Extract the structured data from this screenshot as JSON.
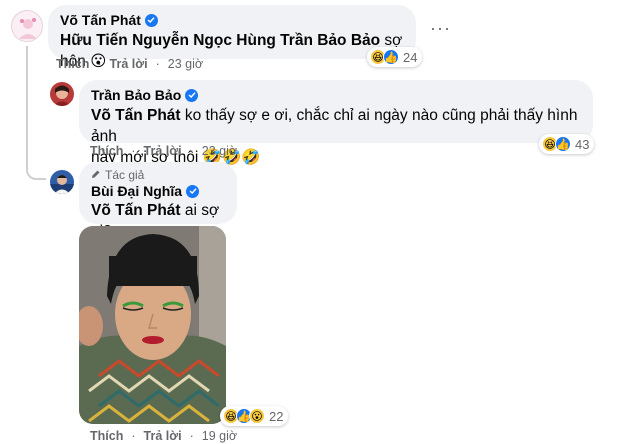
{
  "comment1": {
    "author": "Võ Tấn Phát",
    "text": "Hữu Tiến Nguyễn Ngọc Hùng Trần Bảo Bảo",
    "suffix": " sợ hôn 😮",
    "reaction_count": "24",
    "like": "Thích",
    "reply": "Trả lời",
    "time": "23 giờ",
    "more": "···"
  },
  "comment2": {
    "author": "Trần Bảo Bảo",
    "mention": "Võ Tấn Phát",
    "text": " ko thấy sợ e ơi, chắc chỉ ai ngày nào cũng phải thấy hình ảnh",
    "text2": "này mới sợ thôi 🤣🤣🤣",
    "reaction_count": "43",
    "like": "Thích",
    "reply": "Trả lời",
    "time": "23 giờ"
  },
  "comment3": {
    "author_tag": "Tác giả",
    "author": "Bùi Đại Nghĩa",
    "mention": "Võ Tấn Phát",
    "text": " ai sợ ai?",
    "reaction_count": "22",
    "like": "Thích",
    "reply": "Trả lời",
    "time": "19 giờ"
  },
  "colors": {
    "bubble": "#f0f2f5",
    "secondary_text": "#65676b",
    "verified": "#1877f2"
  },
  "icons": [
    "verified-icon",
    "haha-reaction-icon",
    "like-reaction-icon",
    "wow-reaction-icon",
    "pencil-icon",
    "more-options-icon"
  ]
}
